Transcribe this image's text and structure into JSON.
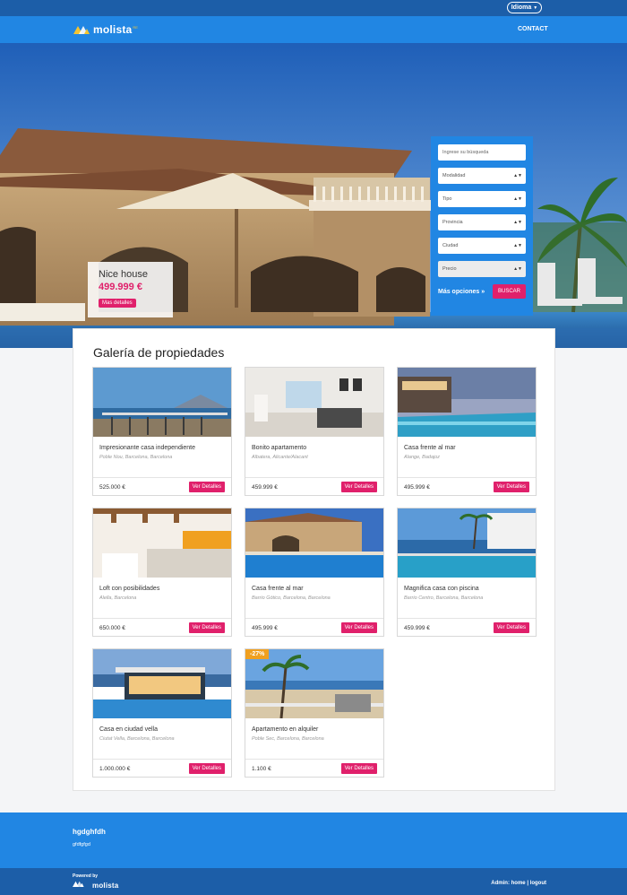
{
  "topbar": {
    "language_label": "Idioma"
  },
  "nav": {
    "logo_text": "molista",
    "logo_sup": "RE",
    "contact_label": "CONTACT"
  },
  "featured": {
    "title": "Nice house",
    "price": "499.999 €",
    "button": "Mas detalles"
  },
  "search": {
    "placeholder": "Ingrese su búsqueda",
    "selects": [
      "Modalidad",
      "Tipo",
      "Provincia",
      "Ciudad",
      "Precio"
    ],
    "more_options": "Más opciones »",
    "submit": "BUSCAR"
  },
  "gallery": {
    "title": "Galería de propiedades",
    "button_label": "Ver Detalles",
    "properties": [
      {
        "title": "Impresionante casa independiente",
        "location": "Poble Nou, Barcelona, Barcelona",
        "price": "525.000 €"
      },
      {
        "title": "Bonito apartamento",
        "location": "Albatera, Alicante/Alacant",
        "price": "459.999 €"
      },
      {
        "title": "Casa frente al mar",
        "location": "Alange, Badajoz",
        "price": "495.999 €"
      },
      {
        "title": "Loft con posibilidades",
        "location": "Alella, Barcelona",
        "price": "650.000 €"
      },
      {
        "title": "Casa frente al mar",
        "location": "Barrio Gótico, Barcelona, Barcelona",
        "price": "495.999 €"
      },
      {
        "title": "Magnifica casa con piscina",
        "location": "Barrio Centro, Barcelona, Barcelona",
        "price": "459.999 €"
      },
      {
        "title": "Casa en ciudad vella",
        "location": "Ciutat Vella, Barcelona, Barcelona",
        "price": "1.000.000 €"
      },
      {
        "title": "Apartamento en alquiler",
        "location": "Poble Sec, Barcelona, Barcelona",
        "price": "1.100 €",
        "badge": "-27%"
      }
    ]
  },
  "footer": {
    "title": "hgdghfdh",
    "subtitle": "gfdfgfgd"
  },
  "bottombar": {
    "powered": "Powered by",
    "logo_text": "molista",
    "admin_prefix": "Admin:",
    "home": "home",
    "separator": "|",
    "logout": "logout"
  },
  "colors": {
    "primary": "#2186e3",
    "dark": "#1c5ea8",
    "accent": "#e0206b",
    "badge": "#f0a020"
  }
}
